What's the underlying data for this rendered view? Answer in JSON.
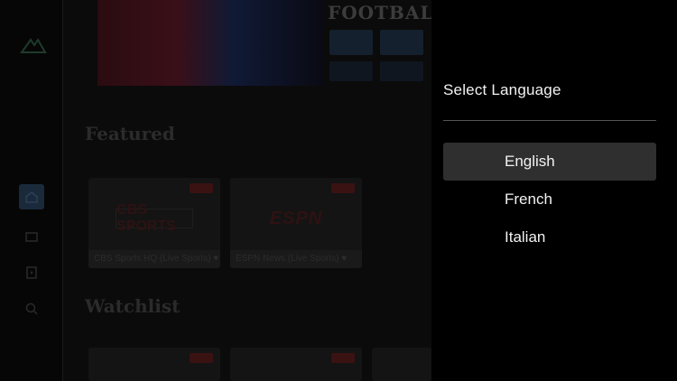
{
  "background": {
    "hero_title": "FOOTBALL T",
    "sections": {
      "featured": "Featured",
      "watchlist": "Watchlist"
    },
    "featured_cards": [
      {
        "logo": "CBS SPORTS",
        "caption": "CBS Sports HQ (Live Sports) ♥"
      },
      {
        "logo": "ESPN",
        "caption": "ESPN News (Live Sports) ♥"
      }
    ]
  },
  "dialog": {
    "title": "Select Language",
    "options": [
      {
        "label": "English",
        "selected": true
      },
      {
        "label": "French",
        "selected": false
      },
      {
        "label": "Italian",
        "selected": false
      }
    ]
  },
  "colors": {
    "dialog_bg": "#000000",
    "selected_row": "#2f2f2f",
    "text": "#f2f2f2",
    "divider": "#555555"
  }
}
